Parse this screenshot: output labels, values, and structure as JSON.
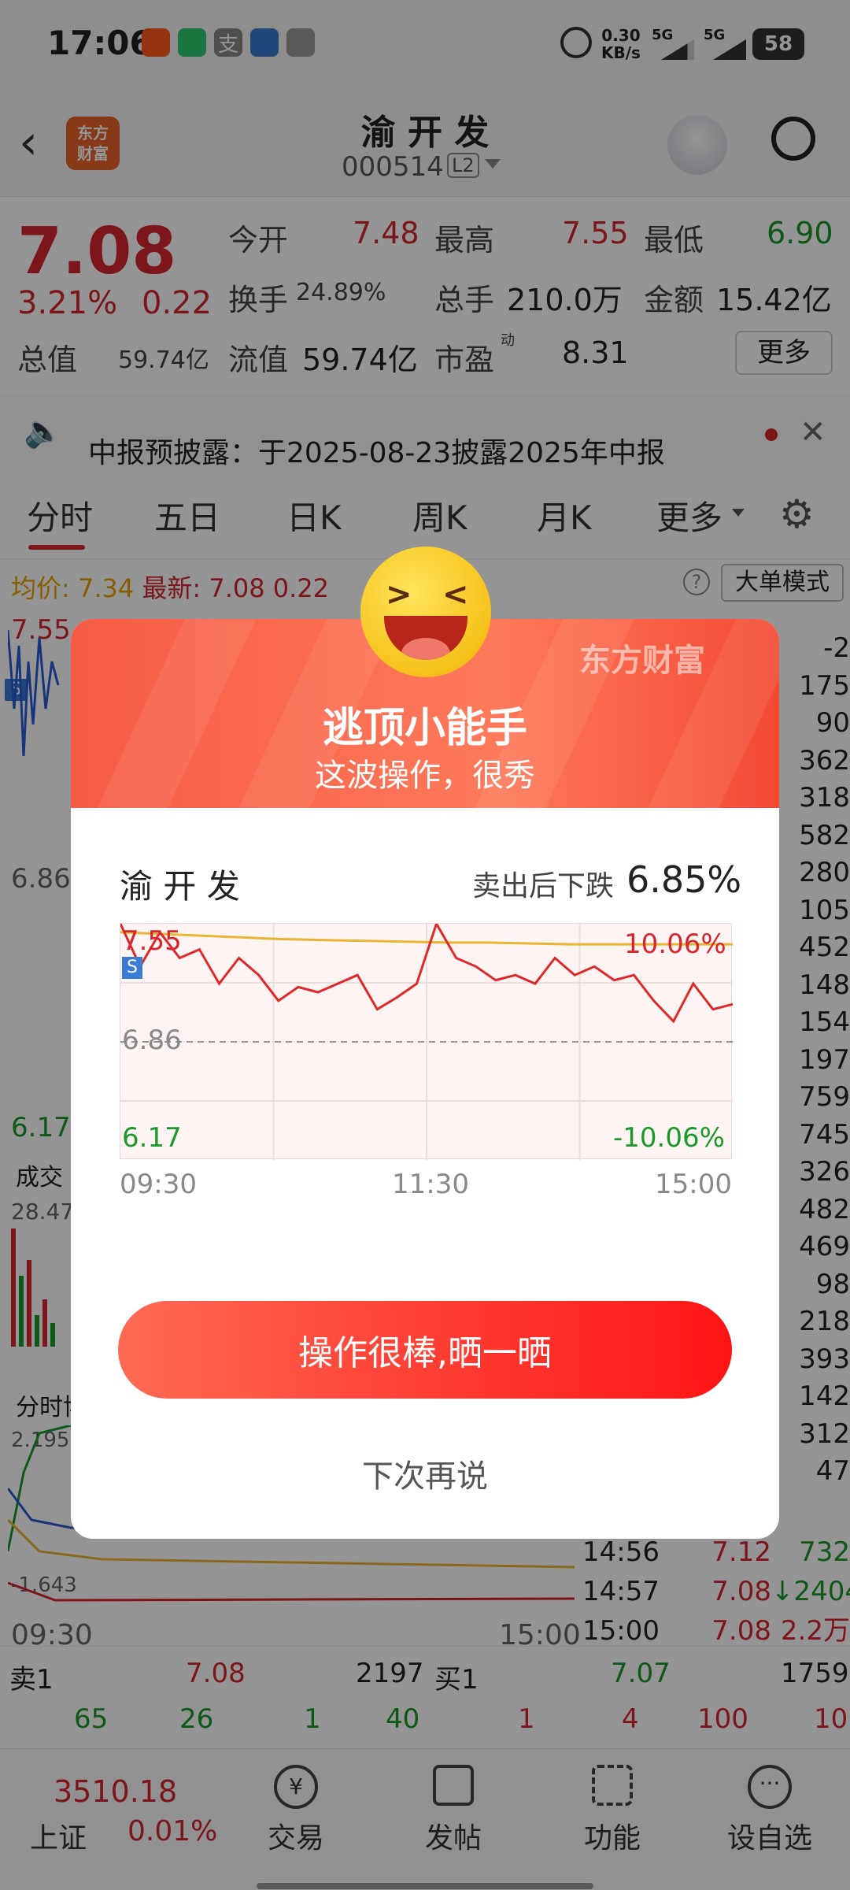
{
  "status_bar": {
    "time": "17:06",
    "net_speed": "0.30",
    "net_unit": "KB/s",
    "sim1": "5G",
    "sim2": "5G",
    "battery": "58"
  },
  "header": {
    "stock_name": "渝 开 发",
    "stock_code": "000514",
    "level_badge": "L2"
  },
  "quote": {
    "price": "7.08",
    "change_pct": "3.21%",
    "change_amt": "0.22",
    "open_label": "今开",
    "open": "7.48",
    "high_label": "最高",
    "high": "7.55",
    "low_label": "最低",
    "low": "6.90",
    "turnover_label": "换手",
    "turnover": "24.89%",
    "volume_label": "总手",
    "volume": "210.0万",
    "amount_label": "金额",
    "amount": "15.42亿",
    "mcap_label": "总值",
    "mcap": "59.74亿",
    "float_label": "流值",
    "float": "59.74亿",
    "pe_label": "市盈",
    "pe_sup": "动",
    "pe": "8.31",
    "more": "更多"
  },
  "notice": {
    "text": "中报预披露：于2025-08-23披露2025年中报"
  },
  "tabs": [
    "分时",
    "五日",
    "日K",
    "周K",
    "月K",
    "更多"
  ],
  "chart_info": {
    "avg_label": "均价:",
    "avg": "7.34",
    "latest_label": "最新:",
    "latest": "7.08",
    "chg": "0.22",
    "mode": "大单模式"
  },
  "bg_chart": {
    "y_high": "7.55",
    "y_mid": "6.86",
    "y_low": "6.17",
    "vol_label": "成交",
    "vol_val": "28.47",
    "game_label": "分时博",
    "g1": "2.195",
    "g2": "-1.643",
    "t_start": "09:30",
    "t_end": "15:00"
  },
  "side_numbers": [
    "-2",
    "175",
    "90",
    "362",
    "318",
    "582",
    "280",
    "105",
    "452",
    "148",
    "154",
    "197",
    "759",
    "745",
    "326",
    "482",
    "469",
    "98",
    "218",
    "393",
    "142",
    "312",
    "47"
  ],
  "ticks": [
    {
      "time": "14:56",
      "price": "7.12",
      "vol": "732"
    },
    {
      "time": "14:57",
      "price": "7.08",
      "vol": "↓2404"
    },
    {
      "time": "15:00",
      "price": "7.08",
      "vol": "2.2万"
    }
  ],
  "orderbook": {
    "sell_label": "卖1",
    "sell_price": "7.08",
    "sell_vol": "2197",
    "buy_label": "买1",
    "buy_price": "7.07",
    "buy_vol": "1759",
    "row2": [
      "65",
      "26",
      "1",
      "40",
      "1",
      "4",
      "100",
      "10"
    ]
  },
  "bottom_nav": {
    "index_value": "3510.18",
    "index_name": "上证",
    "index_chg": "0.01%",
    "items": [
      "交易",
      "发帖",
      "功能",
      "设自选"
    ]
  },
  "modal": {
    "brand": "东方财富",
    "title": "逃顶小能手",
    "subtitle": "这波操作，很秀",
    "stock_name": "渝 开 发",
    "drop_label": "卖出后下跌",
    "drop_value": "6.85%",
    "chart_y_high": "7.55",
    "chart_y_mid": "6.86",
    "chart_y_low": "6.17",
    "chart_pct_high": "10.06%",
    "chart_pct_low": "-10.06%",
    "chart_times": [
      "09:30",
      "11:30",
      "15:00"
    ],
    "sell_marker": "S",
    "share_button": "操作很棒,晒一晒",
    "dismiss": "下次再说"
  },
  "chart_data": {
    "type": "line",
    "title": "",
    "ylim": [
      6.17,
      7.55
    ],
    "x": [
      "09:30",
      "11:30",
      "15:00"
    ],
    "series": [
      {
        "name": "",
        "values": [
          7.5,
          7.49,
          7.48,
          7.47,
          7.46,
          7.455,
          7.45,
          7.445,
          7.44,
          7.44,
          7.435,
          7.43,
          7.43,
          7.43,
          7.43,
          7.43
        ]
      },
      {
        "name": "",
        "values": [
          7.55,
          7.3,
          7.5,
          7.35,
          7.4,
          7.2,
          7.35,
          7.25,
          7.1,
          7.18,
          7.15,
          7.2,
          7.25,
          7.05,
          7.12,
          7.2,
          7.55,
          7.35,
          7.3,
          7.22,
          7.25,
          7.2,
          7.35,
          7.25,
          7.3,
          7.22,
          7.25,
          7.1,
          6.98,
          7.2,
          7.05,
          7.08
        ]
      }
    ]
  },
  "colors": {
    "accent": "#d8262e",
    "up": "#d8262e",
    "down": "#1a9a2a",
    "avg_line": "#e8b431",
    "button": "#ff2a1e"
  }
}
